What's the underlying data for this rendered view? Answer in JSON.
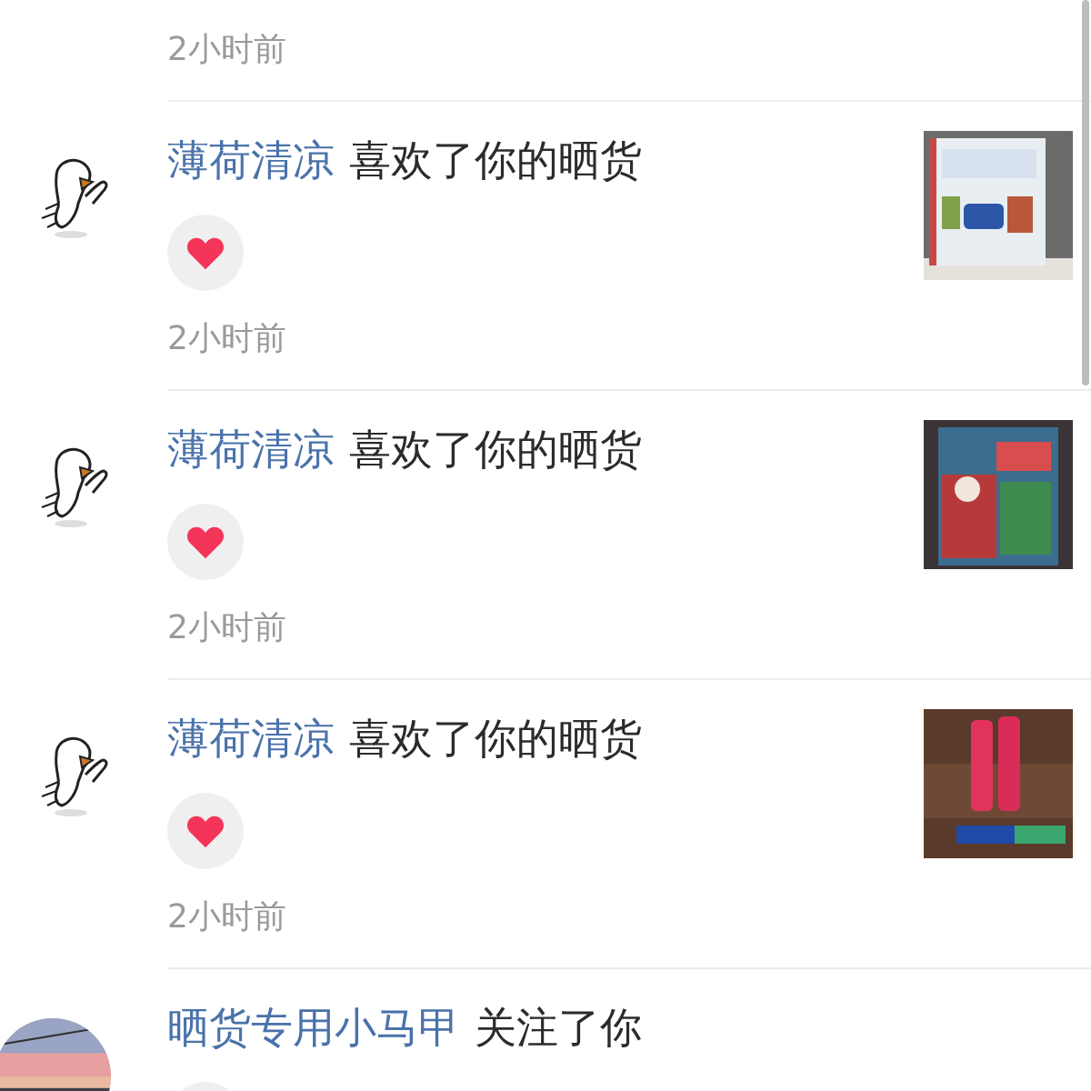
{
  "notifications": [
    {
      "kind": "time_only",
      "time": "2小时前"
    },
    {
      "kind": "like",
      "user": "薄荷清凉",
      "action": "喜欢了你的晒货",
      "time": "2小时前"
    },
    {
      "kind": "like",
      "user": "薄荷清凉",
      "action": "喜欢了你的晒货",
      "time": "2小时前"
    },
    {
      "kind": "like",
      "user": "薄荷清凉",
      "action": "喜欢了你的晒货",
      "time": "2小时前"
    },
    {
      "kind": "follow",
      "user": "晒货专用小马甲",
      "action": "关注了你"
    }
  ]
}
